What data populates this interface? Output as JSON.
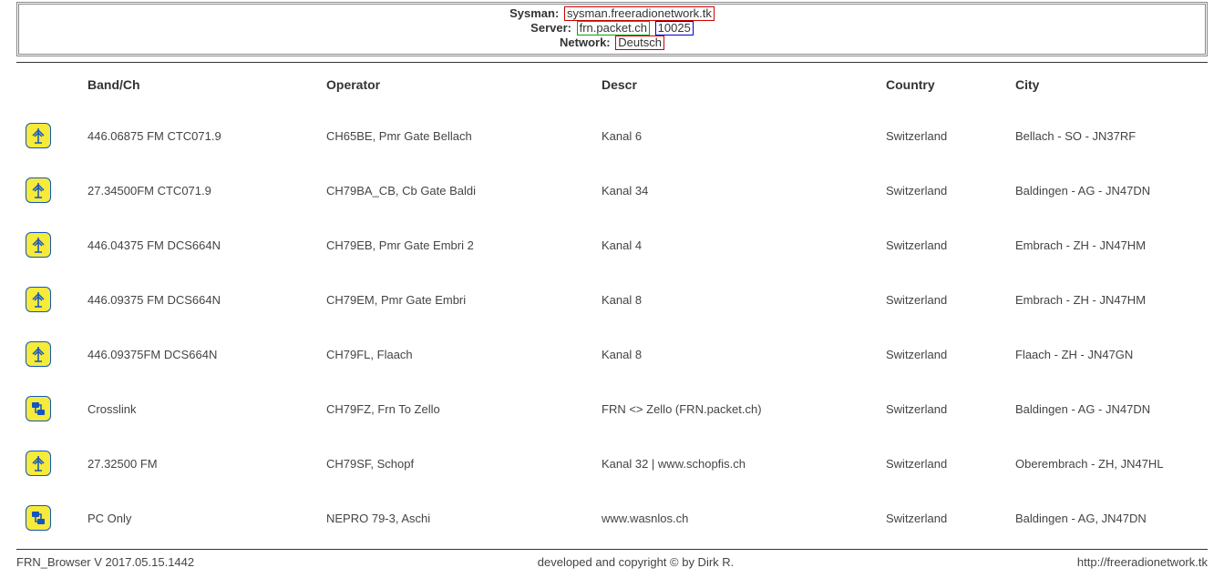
{
  "header": {
    "sysman_label": "Sysman:",
    "sysman_value": "sysman.freeradionetwork.tk",
    "server_label": "Server:",
    "server_host": "frn.packet.ch",
    "server_port": "10025",
    "network_label": "Network:",
    "network_value": "Deutsch"
  },
  "columns": {
    "band": "Band/Ch",
    "operator": "Operator",
    "descr": "Descr",
    "country": "Country",
    "city": "City"
  },
  "rows": [
    {
      "icon": "antenna",
      "band": "446.06875 FM CTC071.9",
      "op": "CH65BE, Pmr Gate Bellach",
      "descr": "Kanal 6",
      "country": "Switzerland",
      "city": "Bellach - SO - JN37RF"
    },
    {
      "icon": "antenna",
      "band": "27.34500FM CTC071.9",
      "op": "CH79BA_CB, Cb Gate Baldi",
      "descr": "Kanal 34",
      "country": "Switzerland",
      "city": "Baldingen - AG - JN47DN"
    },
    {
      "icon": "antenna",
      "band": "446.04375 FM DCS664N",
      "op": "CH79EB, Pmr Gate Embri 2",
      "descr": "Kanal 4",
      "country": "Switzerland",
      "city": "Embrach - ZH - JN47HM"
    },
    {
      "icon": "antenna",
      "band": "446.09375 FM DCS664N",
      "op": "CH79EM, Pmr Gate Embri",
      "descr": "Kanal 8",
      "country": "Switzerland",
      "city": "Embrach - ZH - JN47HM"
    },
    {
      "icon": "antenna",
      "band": "446.09375FM DCS664N",
      "op": "CH79FL, Flaach",
      "descr": "Kanal 8",
      "country": "Switzerland",
      "city": "Flaach - ZH - JN47GN"
    },
    {
      "icon": "crosslink",
      "band": "Crosslink",
      "op": "CH79FZ, Frn To Zello",
      "descr": "FRN <> Zello (FRN.packet.ch)",
      "country": "Switzerland",
      "city": "Baldingen - AG - JN47DN"
    },
    {
      "icon": "antenna",
      "band": "27.32500 FM",
      "op": "CH79SF, Schopf",
      "descr": "Kanal 32 | www.schopfis.ch",
      "country": "Switzerland",
      "city": "Oberembrach - ZH, JN47HL"
    },
    {
      "icon": "crosslink",
      "band": "PC Only",
      "op": "NEPRO 79-3, Aschi",
      "descr": "www.wasnlos.ch",
      "country": "Switzerland",
      "city": "Baldingen - AG, JN47DN"
    }
  ],
  "footer": {
    "version": "FRN_Browser V 2017.05.15.1442",
    "credit": "developed and copyright © by Dirk R.",
    "url": "http://freeradionetwork.tk"
  }
}
